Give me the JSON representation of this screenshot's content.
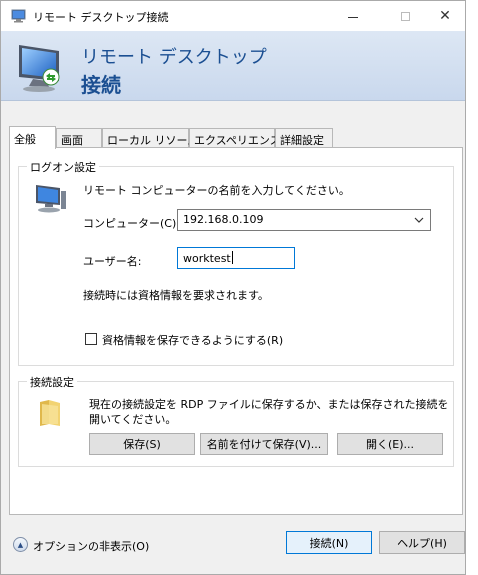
{
  "window": {
    "title": "リモート デスクトップ接続",
    "controls": {
      "minimize": "—",
      "maximize": "☐",
      "close": "✕"
    }
  },
  "banner": {
    "line1": "リモート デスクトップ",
    "line2": "接続"
  },
  "tabs": [
    {
      "label": "全般",
      "active": true
    },
    {
      "label": "画面",
      "active": false
    },
    {
      "label": "ローカル リソース",
      "active": false
    },
    {
      "label": "エクスペリエンス",
      "active": false
    },
    {
      "label": "詳細設定",
      "active": false
    }
  ],
  "logon": {
    "group_title": "ログオン設定",
    "instruction": "リモート コンピューターの名前を入力してください。",
    "computer_label": "コンピューター(C):",
    "computer_value": "192.168.0.109",
    "username_label": "ユーザー名:",
    "username_value": "worktest",
    "credentials_note": "接続時には資格情報を要求されます。",
    "save_credentials_label": "資格情報を保存できるようにする(R)",
    "save_credentials_checked": false
  },
  "connection_settings": {
    "group_title": "接続設定",
    "description_line1": "現在の接続設定を RDP ファイルに保存するか、または保存された接続を",
    "description_line2": "開いてください。",
    "save_button": "保存(S)",
    "save_as_button": "名前を付けて保存(V)...",
    "open_button": "開く(E)..."
  },
  "footer": {
    "options_label": "オプションの非表示(O)",
    "connect_button": "接続(N)",
    "help_button": "ヘルプ(H)"
  },
  "icons": {
    "app": "remote-desktop-icon",
    "banner": "remote-desktop-monitor-icon",
    "logon": "computer-icon",
    "connection": "folder-icon",
    "options": "chevron-up-icon"
  },
  "colors": {
    "banner_text": "#1b4f92",
    "focus_border": "#0078d7"
  }
}
